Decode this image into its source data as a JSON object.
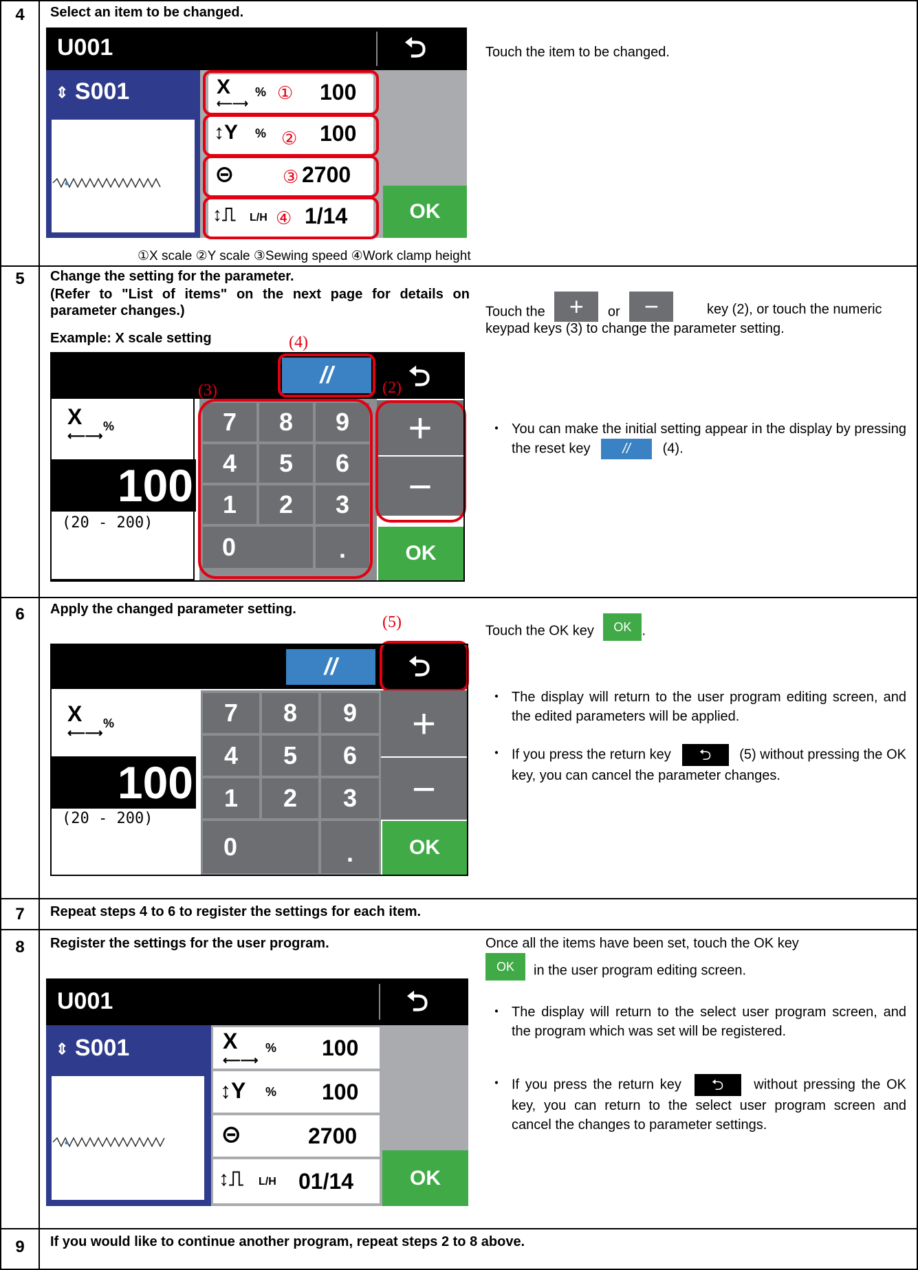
{
  "steps": [
    {
      "num": "4",
      "title": "Select an item to be changed.",
      "desc": "Touch the item to be changed.",
      "legend": "①X scale ②Y scale ③Sewing speed ④Work clamp height"
    },
    {
      "num": "5",
      "title": "Change the setting for the parameter.",
      "title2": "(Refer to \"List of items\" on the next page for details on parameter changes.)",
      "example": "Example: X scale setting",
      "desc_a": "Touch the",
      "desc_or": "or",
      "desc_b": "key (2), or touch the numeric keypad keys (3) to change the parameter setting.",
      "bullet_a": "You can make the initial setting appear in the display by pressing the reset key",
      "bullet_b": "(4)."
    },
    {
      "num": "6",
      "title": "Apply the changed parameter setting.",
      "desc_a": "Touch the OK key",
      "desc_b": ".",
      "bullet1": "The display will return to the user program editing screen, and the edited parameters will be applied.",
      "bullet2_a": "If you press the return key",
      "bullet2_b": "(5) without pressing the OK key, you can cancel the parameter changes."
    },
    {
      "num": "7",
      "title": "Repeat steps 4 to 6 to register the settings for each item."
    },
    {
      "num": "8",
      "title": "Register the settings for the user program.",
      "desc_a": "Once all the items have been set, touch the OK key",
      "desc_b": "in the user program editing screen.",
      "bullet1": "The display will return to the select user program screen, and the program which was set will be registered.",
      "bullet2_a": "If you press the return key",
      "bullet2_b": "without pressing the OK key, you can return to the select user program screen and cancel the changes to parameter settings."
    },
    {
      "num": "9",
      "title": "If you would like to continue another program, repeat steps 2 to 8 above."
    }
  ],
  "screen": {
    "program": "U001",
    "pattern": "S001",
    "ok": "OK",
    "percent": "%",
    "lh": "L/H",
    "x_val": "100",
    "y_val": "100",
    "speed": "2700",
    "clamp": "1/14",
    "clamp2": "01/14",
    "circ1": "①",
    "circ2": "②",
    "circ3": "③",
    "circ4": "④",
    "value": "100",
    "range": "(20  -  200)",
    "keys": [
      "7",
      "8",
      "9",
      "4",
      "5",
      "6",
      "1",
      "2",
      "3",
      "0",
      "."
    ],
    "plus": "+",
    "minus": "−",
    "reset": "//",
    "callout2": "(2)",
    "callout3": "(3)",
    "callout4": "(4)",
    "callout5": "(5)"
  }
}
